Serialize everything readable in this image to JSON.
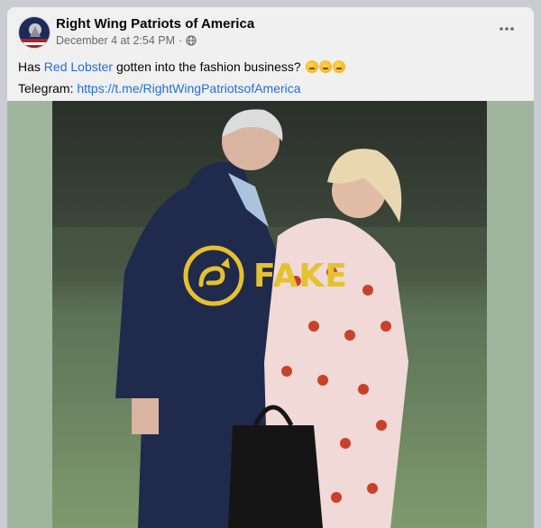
{
  "post": {
    "page_name": "Right Wing Patriots of America",
    "timestamp": "December 4 at 2:54 PM",
    "separator": "·",
    "privacy_icon": "globe-icon",
    "more_icon": "more-options-icon",
    "text": {
      "prefix": "Has ",
      "link": "Red Lobster",
      "suffix": " gotten into the fashion business?",
      "emojis": [
        "thinking-face",
        "thinking-face",
        "thinking-face"
      ]
    },
    "telegram": {
      "label": "Telegram: ",
      "url": "https://t.me/RightWingPatriotsofAmerica"
    }
  },
  "overlay": {
    "label": "FAKE",
    "color": "#e6c12e"
  },
  "colors": {
    "link": "#216fdb",
    "media_bg": "#9fb59e"
  }
}
